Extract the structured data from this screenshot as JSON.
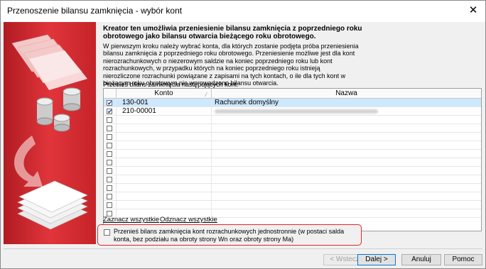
{
  "window": {
    "title": "Przenoszenie bilansu zamknięcia - wybór kont",
    "close_glyph": "✕"
  },
  "intro": {
    "bold": "Kreator ten umożliwia przeniesienie bilansu zamknięcia z poprzedniego roku obrotowego jako bilansu otwarcia bieżącego roku obrotowego.",
    "body": "W pierwszym kroku należy wybrać konta, dla których zostanie podjęta próba przeniesienia bilansu zamknięcia z poprzedniego roku obrotowego. Przeniesienie możliwe jest dla kont nierozrachunkowych o niezerowym saldzie na koniec poprzedniego roku lub kont rozrachunkowych, w przypadku których na koniec poprzedniego roku istnieją nierozliczone rozrachunki powiązane z zapisami na tych kontach, o ile dla tych kont w bieżącym roku obrotowym nie wprowadzono bilansu otwarcia."
  },
  "grid": {
    "label": "Przenieś bilans zamknięcia następujących kont:",
    "columns": {
      "konto": "Konto",
      "nazwa": "Nazwa"
    },
    "rows": [
      {
        "checked": true,
        "konto": "130-001",
        "nazwa": "Rachunek domyślny",
        "selected": true,
        "blurred": false
      },
      {
        "checked": true,
        "konto": "210-00001",
        "nazwa": "",
        "selected": false,
        "blurred": true
      },
      {
        "checked": false,
        "konto": "",
        "nazwa": ""
      },
      {
        "checked": false,
        "konto": "",
        "nazwa": ""
      },
      {
        "checked": false,
        "konto": "",
        "nazwa": ""
      },
      {
        "checked": false,
        "konto": "",
        "nazwa": ""
      },
      {
        "checked": false,
        "konto": "",
        "nazwa": ""
      },
      {
        "checked": false,
        "konto": "",
        "nazwa": ""
      },
      {
        "checked": false,
        "konto": "",
        "nazwa": ""
      },
      {
        "checked": false,
        "konto": "",
        "nazwa": ""
      },
      {
        "checked": false,
        "konto": "",
        "nazwa": ""
      },
      {
        "checked": false,
        "konto": "",
        "nazwa": ""
      },
      {
        "checked": false,
        "konto": "",
        "nazwa": ""
      },
      {
        "checked": false,
        "konto": "",
        "nazwa": ""
      }
    ]
  },
  "links": {
    "select_all": "Zaznacz wszystkie",
    "deselect_all": "Odznacz wszystkie"
  },
  "option": {
    "checked": false,
    "label": "Przenieś bilans zamknięcia kont rozrachunkowych jednostronnie (w postaci salda konta, bez podziału na obroty strony Wn oraz obroty strony Ma)"
  },
  "buttons": {
    "back": "< Wstecz",
    "next": "Dalej >",
    "cancel": "Anuluj",
    "help": "Pomoc"
  },
  "colors": {
    "side_red": "#d8262d",
    "highlight": "#e0242c",
    "selection": "#cde8ff"
  }
}
